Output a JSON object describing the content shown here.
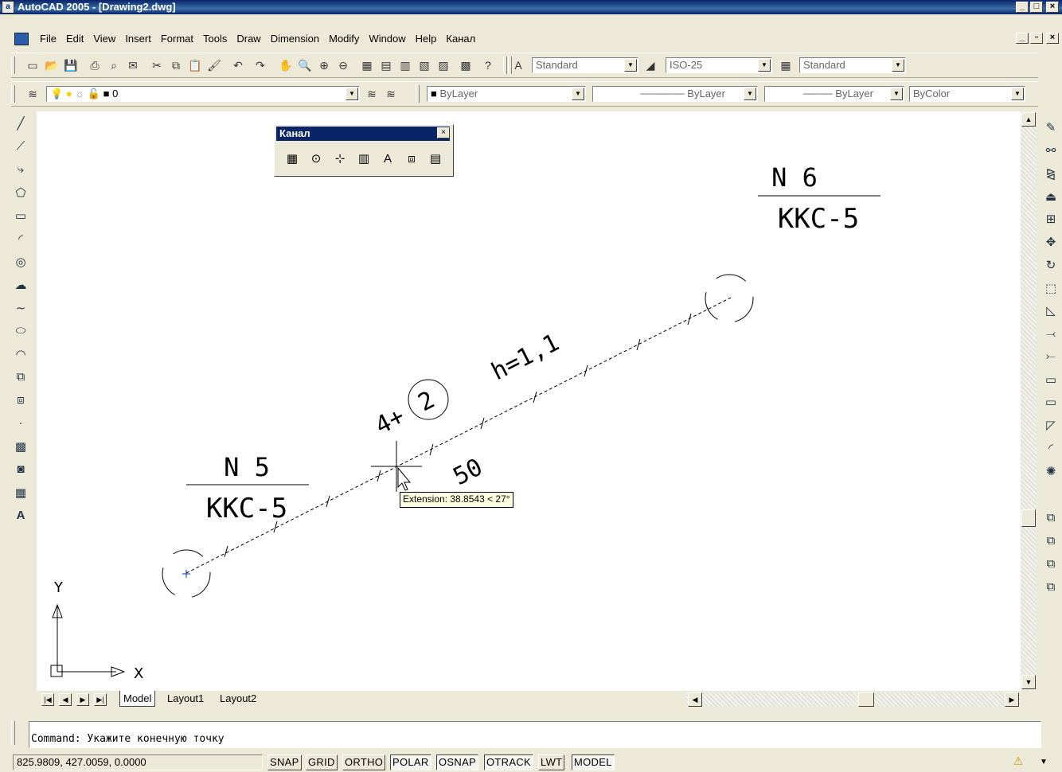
{
  "window": {
    "title": "AutoCAD 2005 - [Drawing2.dwg]",
    "app_icon": "autocad-icon"
  },
  "menu": {
    "items": [
      "File",
      "Edit",
      "View",
      "Insert",
      "Format",
      "Tools",
      "Draw",
      "Dimension",
      "Modify",
      "Window",
      "Help",
      "Канал"
    ]
  },
  "styles_toolbar": {
    "text_style": "Standard",
    "dim_style": "ISO-25",
    "table_style": "Standard"
  },
  "layers_toolbar": {
    "layer": "0",
    "color": "ByLayer",
    "linetype": "ByLayer",
    "lineweight": "ByLayer",
    "plotstyle": "ByColor"
  },
  "floating_toolbar": {
    "title": "Канал"
  },
  "drawing": {
    "label_n6": "N 6",
    "label_kkc_top": "KKC-5",
    "label_n5": "N 5",
    "label_kkc_bottom": "KKC-5",
    "label_h": "h=1,1",
    "label_4plus": "4+",
    "label_circle_num": "2",
    "label_50": "50",
    "axis_y": "Y",
    "axis_x": "X"
  },
  "tooltip": {
    "text": "Extension: 38.8543 < 27°"
  },
  "tabs": [
    "Model",
    "Layout1",
    "Layout2"
  ],
  "command_line": {
    "text": "Command: Укажите конечную точку"
  },
  "status_bar": {
    "coordinates": "825.9809, 427.0059, 0.0000",
    "toggles": [
      {
        "label": "SNAP",
        "on": false
      },
      {
        "label": "GRID",
        "on": false
      },
      {
        "label": "ORTHO",
        "on": false
      },
      {
        "label": "POLAR",
        "on": true
      },
      {
        "label": "OSNAP",
        "on": true
      },
      {
        "label": "OTRACK",
        "on": true
      },
      {
        "label": "LWT",
        "on": false
      },
      {
        "label": "MODEL",
        "on": true
      }
    ]
  }
}
